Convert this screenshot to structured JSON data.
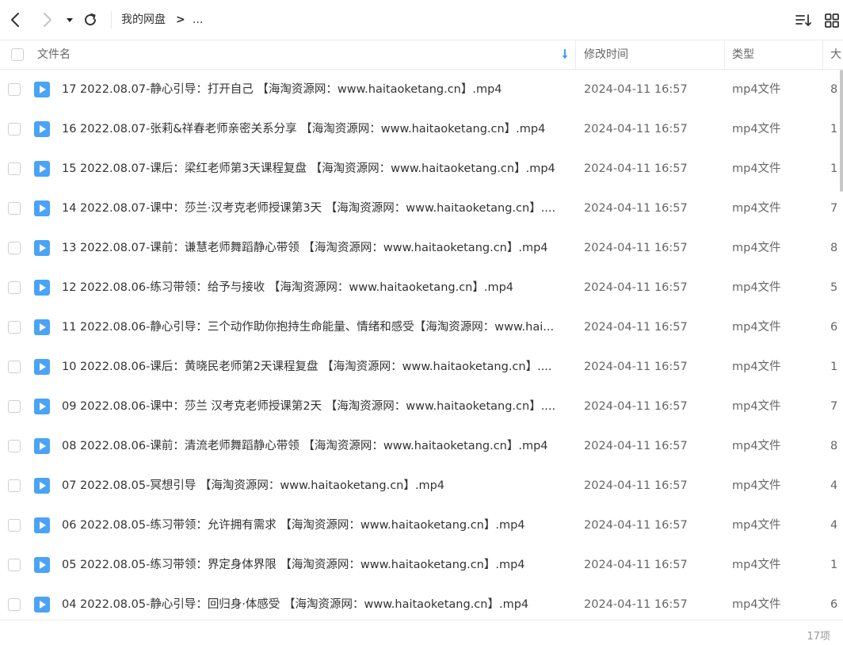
{
  "toolbar": {
    "breadcrumb_root": "我的网盘",
    "breadcrumb_sep": ">",
    "breadcrumb_more": "..."
  },
  "table": {
    "headers": {
      "name": "文件名",
      "modified": "修改时间",
      "type": "类型",
      "size": "大"
    },
    "rows": [
      {
        "name": "17 2022.08.07-静心引导：打开自己 【海淘资源网：www.haitaoketang.cn】.mp4",
        "modified": "2024-04-11 16:57",
        "type": "mp4文件",
        "size": "8"
      },
      {
        "name": "16 2022.08.07-张莉&祥春老师亲密关系分享 【海淘资源网：www.haitaoketang.cn】.mp4",
        "modified": "2024-04-11 16:57",
        "type": "mp4文件",
        "size": "1"
      },
      {
        "name": "15 2022.08.07-课后：梁红老师第3天课程复盘 【海淘资源网：www.haitaoketang.cn】.mp4",
        "modified": "2024-04-11 16:57",
        "type": "mp4文件",
        "size": "1"
      },
      {
        "name": "14 2022.08.07-课中：莎兰·汉考克老师授课第3天 【海淘资源网：www.haitaoketang.cn】....",
        "modified": "2024-04-11 16:57",
        "type": "mp4文件",
        "size": "7"
      },
      {
        "name": "13 2022.08.07-课前：谦慧老师舞蹈静心带领 【海淘资源网：www.haitaoketang.cn】.mp4",
        "modified": "2024-04-11 16:57",
        "type": "mp4文件",
        "size": "8"
      },
      {
        "name": "12 2022.08.06-练习带领：给予与接收 【海淘资源网：www.haitaoketang.cn】.mp4",
        "modified": "2024-04-11 16:57",
        "type": "mp4文件",
        "size": "5"
      },
      {
        "name": "11 2022.08.06-静心引导：三个动作助你抱持生命能量、情绪和感受【海淘资源网：www.hai...",
        "modified": "2024-04-11 16:57",
        "type": "mp4文件",
        "size": "6"
      },
      {
        "name": "10 2022.08.06-课后：黄晓民老师第2天课程复盘 【海淘资源网：www.haitaoketang.cn】....",
        "modified": "2024-04-11 16:57",
        "type": "mp4文件",
        "size": "1"
      },
      {
        "name": "09 2022.08.06-课中：莎兰 汉考克老师授课第2天 【海淘资源网：www.haitaoketang.cn】....",
        "modified": "2024-04-11 16:57",
        "type": "mp4文件",
        "size": "7"
      },
      {
        "name": "08 2022.08.06-课前：清流老师舞蹈静心带领 【海淘资源网：www.haitaoketang.cn】.mp4",
        "modified": "2024-04-11 16:57",
        "type": "mp4文件",
        "size": "8"
      },
      {
        "name": "07 2022.08.05-冥想引导 【海淘资源网：www.haitaoketang.cn】.mp4",
        "modified": "2024-04-11 16:57",
        "type": "mp4文件",
        "size": "4"
      },
      {
        "name": "06 2022.08.05-练习带领：允许拥有需求 【海淘资源网：www.haitaoketang.cn】.mp4",
        "modified": "2024-04-11 16:57",
        "type": "mp4文件",
        "size": "4"
      },
      {
        "name": "05 2022.08.05-练习带领：界定身体界限 【海淘资源网：www.haitaoketang.cn】.mp4",
        "modified": "2024-04-11 16:57",
        "type": "mp4文件",
        "size": "1"
      },
      {
        "name": "04 2022.08.05-静心引导：回归身·体感受 【海淘资源网：www.haitaoketang.cn】.mp4",
        "modified": "2024-04-11 16:57",
        "type": "mp4文件",
        "size": "6"
      }
    ]
  },
  "footer": {
    "item_count": "17项"
  },
  "icons": {
    "back": "chevron-left-icon",
    "forward": "chevron-right-icon",
    "history": "caret-down-icon",
    "refresh": "refresh-icon",
    "sort": "sort-icon",
    "view": "grid-view-icon",
    "file": "video-file-icon",
    "sort_arrow": "arrow-down-icon"
  },
  "colors": {
    "accent": "#3f9cf5",
    "file_icon": "#4aa3f5",
    "disabled": "#c4c4c4"
  }
}
